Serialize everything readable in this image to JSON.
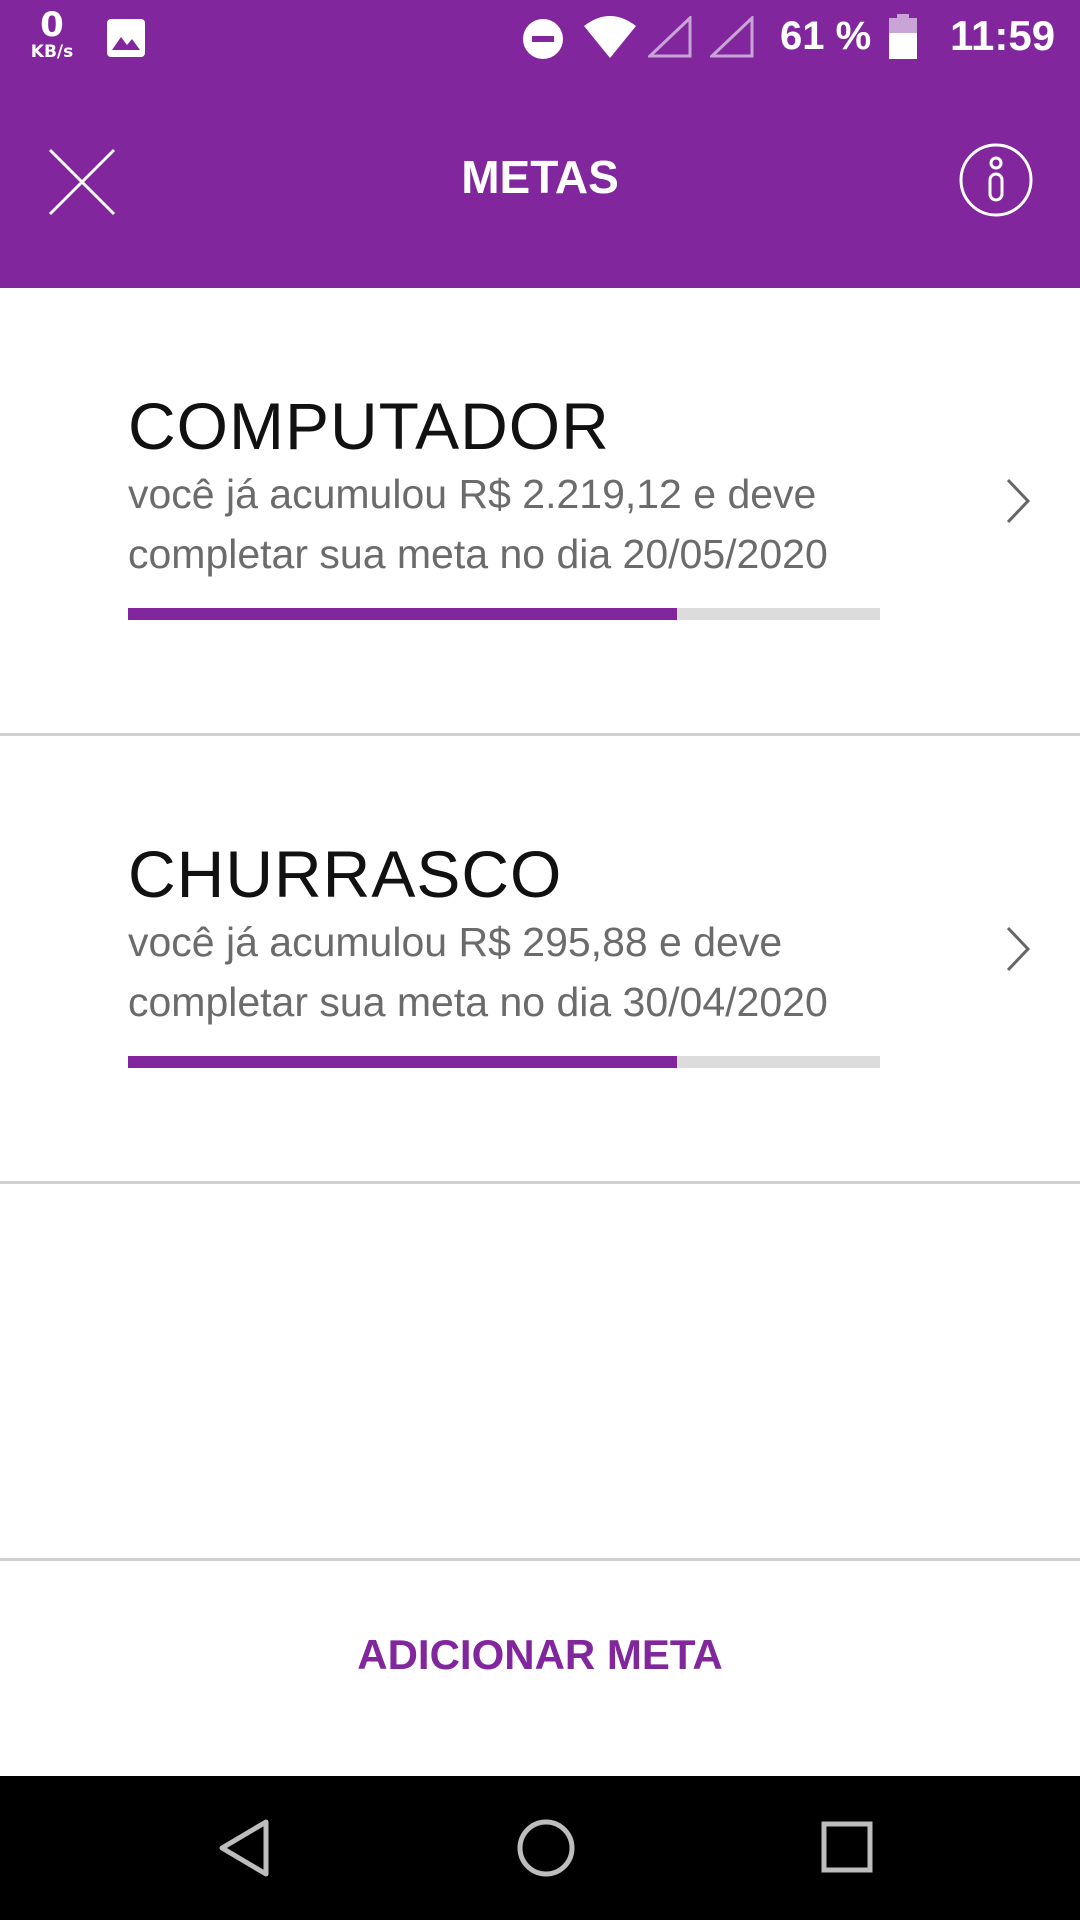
{
  "status_bar": {
    "net_speed": "0",
    "net_unit": "KB/s",
    "battery_pct": "61 %",
    "time": "11:59",
    "icons": [
      "image-icon",
      "do-not-disturb-icon",
      "wifi-icon",
      "signal-icon",
      "signal-icon",
      "battery-icon"
    ]
  },
  "header": {
    "title": "METAS",
    "close_icon": "close-icon",
    "info_icon": "info-icon",
    "background": "#82269e"
  },
  "goals": [
    {
      "title": "COMPUTADOR",
      "description": "você já acumulou R$ 2.219,12 e deve completar sua meta no dia 20/05/2020",
      "progress": 0.73
    },
    {
      "title": "CHURRASCO",
      "description": "você já acumulou R$ 295,88 e deve completar sua meta no dia 30/04/2020",
      "progress": 0.73
    }
  ],
  "add_button": {
    "label": "ADICIONAR META"
  },
  "colors": {
    "accent": "#82269e",
    "track": "#dcdcdc"
  }
}
